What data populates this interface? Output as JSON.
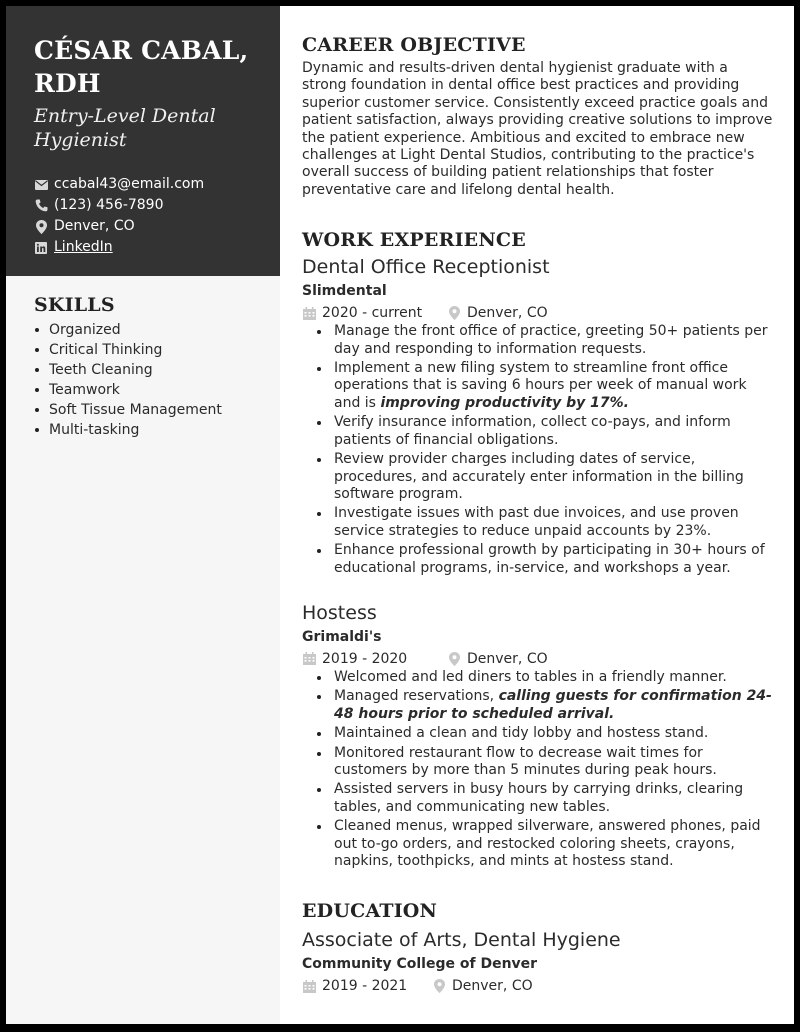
{
  "header": {
    "name": "CÉSAR CABAL, RDH",
    "title": "Entry-Level Dental Hygienist",
    "contacts": [
      {
        "icon": "envelope-icon",
        "text": "ccabal43@email.com"
      },
      {
        "icon": "phone-icon",
        "text": "(123) 456-7890"
      },
      {
        "icon": "location-pin-icon",
        "text": "Denver, CO"
      },
      {
        "icon": "linkedin-icon",
        "text": "LinkedIn"
      }
    ]
  },
  "skills": {
    "heading": "SKILLS",
    "items": [
      "Organized",
      "Critical Thinking",
      "Teeth Cleaning",
      "Teamwork",
      "Soft Tissue Management",
      "Multi-tasking"
    ]
  },
  "objective": {
    "heading": "CAREER OBJECTIVE",
    "text": "Dynamic and results-driven dental hygienist graduate with a strong foundation in dental office best practices and providing superior customer service. Consistently exceed practice goals and patient satisfaction, always providing creative solutions to improve the patient experience. Ambitious and excited to embrace new challenges at Light Dental Studios, contributing to the practice's overall success of building patient relationships that foster preventative care and lifelong dental health."
  },
  "experience": {
    "heading": "WORK EXPERIENCE",
    "jobs": [
      {
        "title": "Dental Office Receptionist",
        "company": "Slimdental",
        "dates": "2020 - current",
        "location": "Denver, CO",
        "bullets": [
          {
            "text": "Manage the front office of practice, greeting 50+ patients per day and responding to information requests.",
            "emphasis": ""
          },
          {
            "text": "Implement a new filing system to streamline front office operations that is saving 6 hours per week of manual work and is ",
            "emphasis": "improving productivity by 17%."
          },
          {
            "text": "Verify insurance information, collect co-pays, and inform patients of financial obligations.",
            "emphasis": ""
          },
          {
            "text": "Review provider charges including dates of service, procedures, and accurately enter information in the billing software program.",
            "emphasis": ""
          },
          {
            "text": "Investigate issues with past due invoices, and use proven service strategies to reduce unpaid accounts by 23%.",
            "emphasis": ""
          },
          {
            "text": "Enhance professional growth by participating in 30+ hours of educational programs, in-service, and workshops a year.",
            "emphasis": ""
          }
        ]
      },
      {
        "title": "Hostess",
        "company": "Grimaldi's",
        "dates": "2019 - 2020",
        "location": "Denver, CO",
        "bullets": [
          {
            "text": "Welcomed and led diners to tables in a friendly manner.",
            "emphasis": ""
          },
          {
            "text": "Managed reservations, ",
            "emphasis": "calling guests for confirmation 24-48 hours prior to scheduled arrival."
          },
          {
            "text": "Maintained a clean and tidy lobby and hostess stand.",
            "emphasis": ""
          },
          {
            "text": "Monitored restaurant flow to decrease wait times for customers by more than 5 minutes during peak hours.",
            "emphasis": ""
          },
          {
            "text": "Assisted servers in busy hours by carrying drinks, clearing tables, and communicating new tables.",
            "emphasis": ""
          },
          {
            "text": "Cleaned menus, wrapped silverware, answered phones, paid out to-go orders, and restocked coloring sheets, crayons, napkins, toothpicks, and mints at hostess stand.",
            "emphasis": ""
          }
        ]
      }
    ]
  },
  "education": {
    "heading": "EDUCATION",
    "degree": "Associate of Arts, Dental Hygiene",
    "school": "Community College of Denver",
    "dates": "2019 - 2021",
    "location": "Denver, CO"
  },
  "colors": {
    "sidebar_header_bg": "#333333",
    "sidebar_bg": "#f6f6f6",
    "text": "#2b2b2b",
    "meta_icon": "#c8c8c8"
  }
}
